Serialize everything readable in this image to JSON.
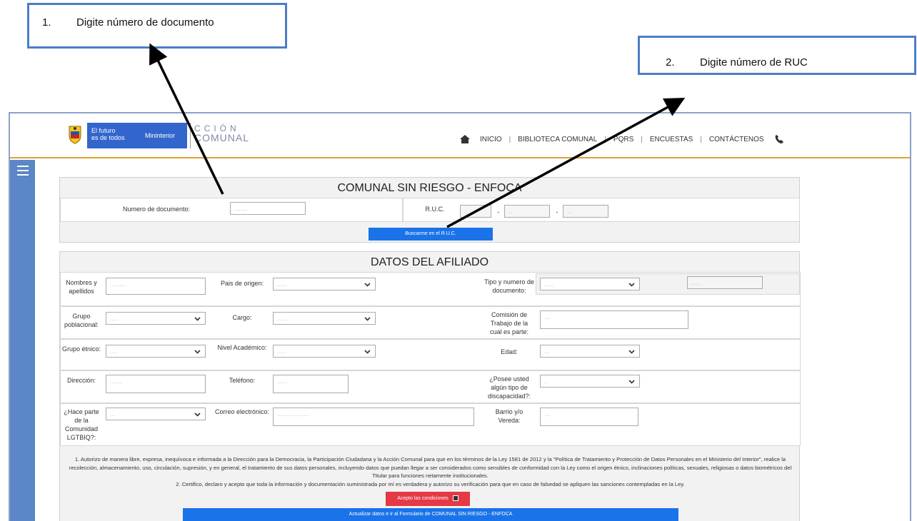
{
  "callouts": [
    {
      "num": "1.",
      "text": "Digite número de documento"
    },
    {
      "num": "2.",
      "text": "Digite número de RUC"
    }
  ],
  "header": {
    "logo_line1": "El futuro",
    "logo_line2": "es de todos",
    "logo_ministry": "Mininterior",
    "brand_top": "CCIÓN",
    "brand_bottom": "COMUNAL",
    "nav": [
      "INICIO",
      "BIBLIOTECA COMUNAL",
      "PQRS",
      "ENCUESTAS",
      "CONTÁCTENOS"
    ]
  },
  "ruc_section": {
    "title": "COMUNAL SIN RIESGO - ENFOCA",
    "doc_label": "Numero de documento:",
    "ruc_label": "R.U.C.",
    "ruc_sep": "-",
    "search_button": "Buscarme en el R.U.C."
  },
  "affiliate": {
    "title": "DATOS DEL AFILIADO",
    "fields": {
      "nombres": "Nombres y apellidos",
      "pais": "Pais de origen:",
      "tipo_doc": "Tipo y numero de documento:",
      "grupo_pob": "Grupo poblacional:",
      "cargo": "Cargo:",
      "comision": "Comisión de Trabajo de la cual es parte:",
      "grupo_etnico": "Grupo étnico:",
      "nivel": "Nivel Académico:",
      "edad": "Edad:",
      "direccion": "Dirección:",
      "telefono": "Teléfono:",
      "discapacidad": "¿Posee usted algún tipo de discapacidad?:",
      "lgtbiq": "¿Hace parte de la Comunidad LGTBIQ?:",
      "correo": "Correo electrónico:",
      "barrio": "Barrio y/o Vereda:"
    },
    "consent_1": "1. Autorizo de manera libre, expresa, inequívoca e informada a la Dirección para la Democracia, la Participación Ciudadana y la Acción Comunal para que en los términos de la Ley 1581 de 2012 y la \"Política de Tratamiento y Protección de Datos Personales en el Ministerio del Interior\", realice la recolección, almacenamiento, uso, circulación, supresión, y en general, el tratamiento de sus datos personales, incluyendo datos que puedan llegar a ser considerados como sensibles de conformidad con la Ley como el origen étnico, inclinaciones políticas, sexuales, religiosas o datos biométricos del Titular para funciones netamente institucionales.",
    "consent_2": "2. Certifico, declaro y acepto que toda la información y documentación suministrada por mí es verdadera y autorizo su verificación para que en caso de falsedad se apliquen las sanciones contempladas en la Ley.",
    "accept_button": "Acepto las condiciones",
    "submit_button": "Actualizar datos e ir al Formulario de COMUNAL SIN RIESGO - ENFOCA"
  },
  "colors": {
    "accent_blue": "#1a73e8",
    "accept_red": "#e53945",
    "sidebar": "#5b86c7",
    "header_border": "#d9a233"
  }
}
